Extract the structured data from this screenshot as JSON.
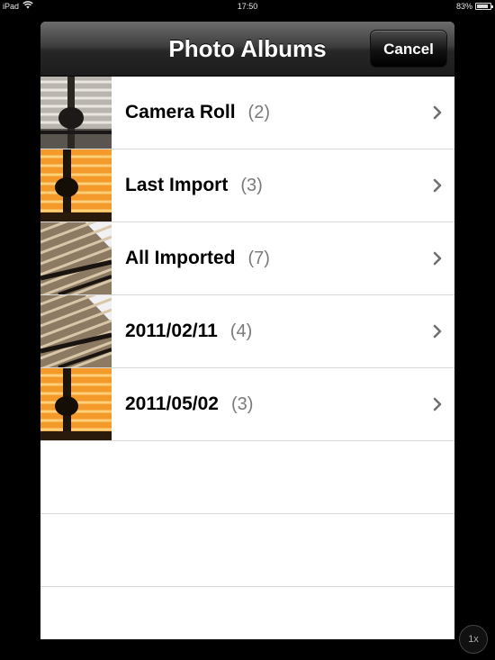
{
  "status_bar": {
    "device": "iPad",
    "time": "17:50",
    "battery": "83%",
    "battery_level": 0.83
  },
  "navbar": {
    "title": "Photo Albums",
    "cancel_label": "Cancel"
  },
  "albums": [
    {
      "name": "Camera Roll",
      "count": "(2)",
      "thumb": "grey-beam"
    },
    {
      "name": "Last Import",
      "count": "(3)",
      "thumb": "orange-beam"
    },
    {
      "name": "All Imported",
      "count": "(7)",
      "thumb": "striped-roof"
    },
    {
      "name": "2011/02/11",
      "count": "(4)",
      "thumb": "striped-roof"
    },
    {
      "name": "2011/05/02",
      "count": "(3)",
      "thumb": "orange-beam"
    }
  ],
  "zoom": {
    "label": "1x"
  }
}
